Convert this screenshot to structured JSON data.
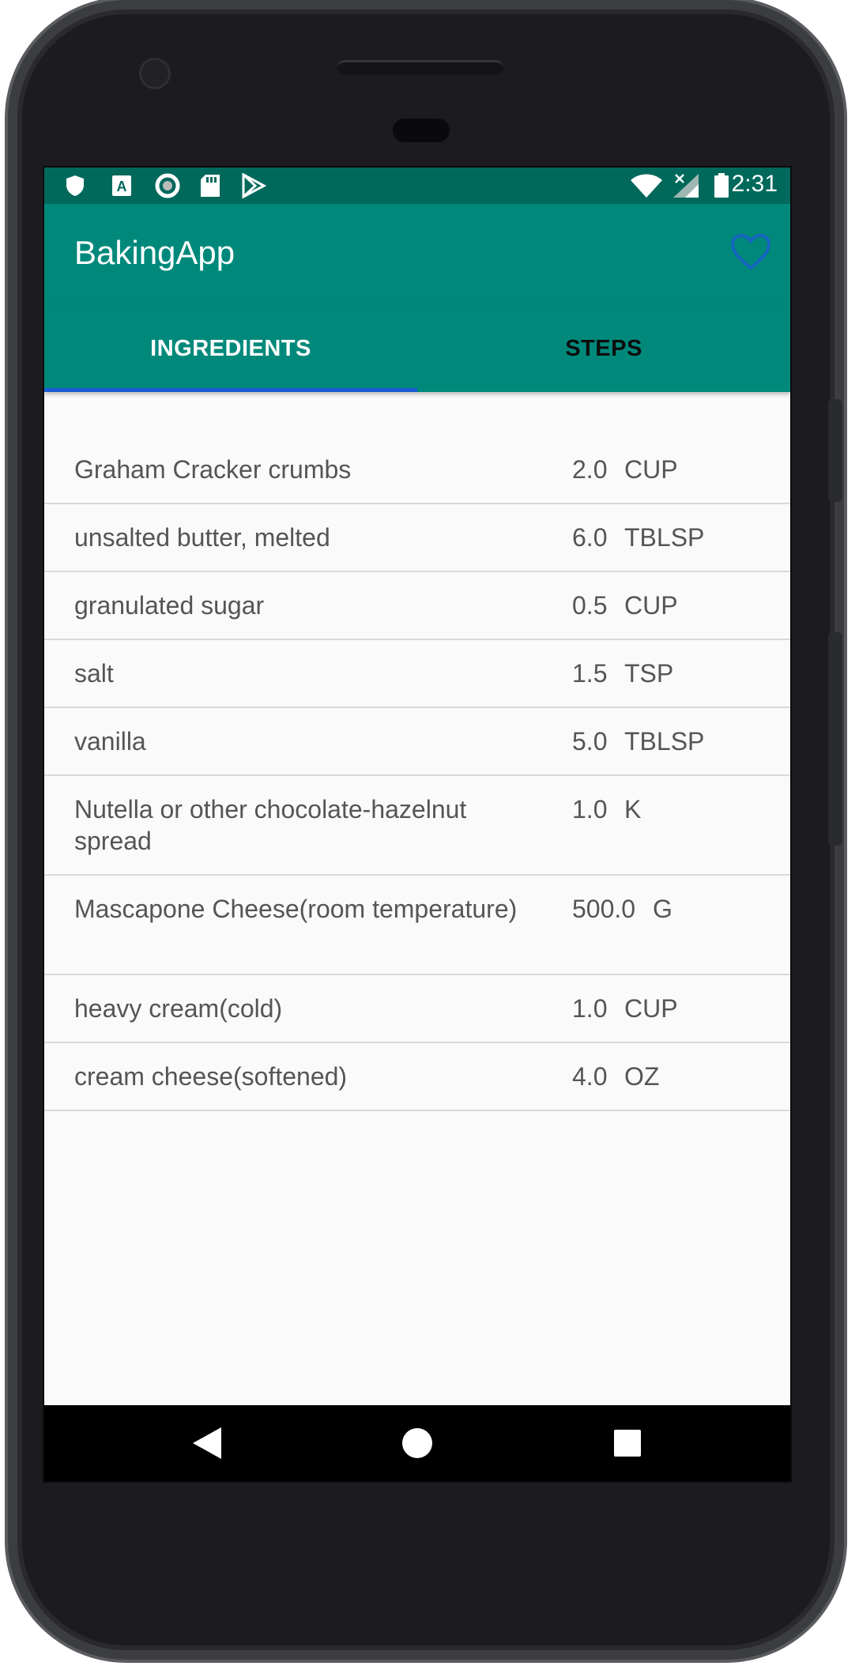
{
  "status_bar": {
    "time": "2:31",
    "left_icons": [
      "shield-icon",
      "a-badge-icon",
      "circle-icon",
      "sd-card-icon",
      "play-store-icon"
    ],
    "right_icons": [
      "wifi-icon",
      "signal-icon",
      "battery-icon"
    ]
  },
  "app_bar": {
    "title": "BakingApp",
    "favorite_icon": "heart-outline-icon"
  },
  "tabs": [
    {
      "label": "INGREDIENTS",
      "active": true
    },
    {
      "label": "STEPS",
      "active": false
    }
  ],
  "ingredients": [
    {
      "name": "Graham Cracker crumbs",
      "quantity": "2.0",
      "unit": "CUP"
    },
    {
      "name": "unsalted butter, melted",
      "quantity": "6.0",
      "unit": "TBLSP"
    },
    {
      "name": "granulated sugar",
      "quantity": "0.5",
      "unit": "CUP"
    },
    {
      "name": "salt",
      "quantity": "1.5",
      "unit": "TSP"
    },
    {
      "name": "vanilla",
      "quantity": "5.0",
      "unit": "TBLSP"
    },
    {
      "name": "Nutella or other chocolate-hazelnut spread",
      "quantity": "1.0",
      "unit": "K"
    },
    {
      "name": "Mascapone Cheese(room temperature)",
      "quantity": "500.0",
      "unit": "G"
    },
    {
      "name": "heavy cream(cold)",
      "quantity": "1.0",
      "unit": "CUP"
    },
    {
      "name": "cream cheese(softened)",
      "quantity": "4.0",
      "unit": "OZ"
    }
  ],
  "nav_bar": [
    "back-icon",
    "home-icon",
    "recents-icon"
  ],
  "colors": {
    "status_bar": "#00695c",
    "app_bar": "#00897b",
    "tab_indicator": "#1a5bd4",
    "favorite_icon": "#1565c0"
  }
}
